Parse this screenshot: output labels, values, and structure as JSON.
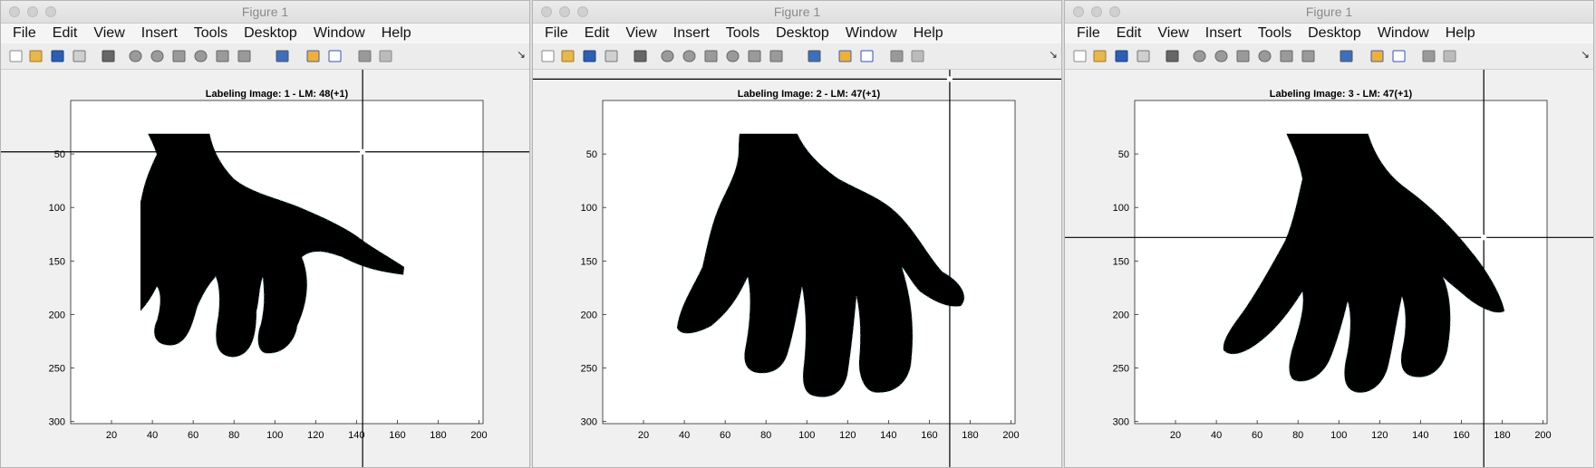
{
  "windows": [
    {
      "title": "Figure 1",
      "menu": [
        "File",
        "Edit",
        "View",
        "Insert",
        "Tools",
        "Desktop",
        "Window",
        "Help"
      ],
      "axes_title": "Labeling Image: 1 - LM: 48(+1)",
      "cursor": {
        "x": 143,
        "y": 48
      },
      "y_ticks": [
        50,
        100,
        150,
        200,
        250,
        300
      ],
      "x_ticks": [
        20,
        40,
        60,
        80,
        100,
        120,
        140,
        160,
        180,
        200
      ]
    },
    {
      "title": "Figure 1",
      "menu": [
        "File",
        "Edit",
        "View",
        "Insert",
        "Tools",
        "Desktop",
        "Window",
        "Help"
      ],
      "axes_title": "Labeling Image: 2 - LM: 47(+1)",
      "cursor": {
        "x": 170,
        "y": -20
      },
      "y_ticks": [
        50,
        100,
        150,
        200,
        250,
        300
      ],
      "x_ticks": [
        20,
        40,
        60,
        80,
        100,
        120,
        140,
        160,
        180,
        200
      ]
    },
    {
      "title": "Figure 1",
      "menu": [
        "File",
        "Edit",
        "View",
        "Insert",
        "Tools",
        "Desktop",
        "Window",
        "Help"
      ],
      "axes_title": "Labeling Image: 3 - LM: 47(+1)",
      "cursor": {
        "x": 171,
        "y": 128
      },
      "y_ticks": [
        50,
        100,
        150,
        200,
        250,
        300
      ],
      "x_ticks": [
        20,
        40,
        60,
        80,
        100,
        120,
        140,
        160,
        180,
        200
      ]
    }
  ],
  "colors": {
    "landmark": "#2ec4c4",
    "silhouette": "#000000",
    "axes_bg": "#ffffff"
  }
}
